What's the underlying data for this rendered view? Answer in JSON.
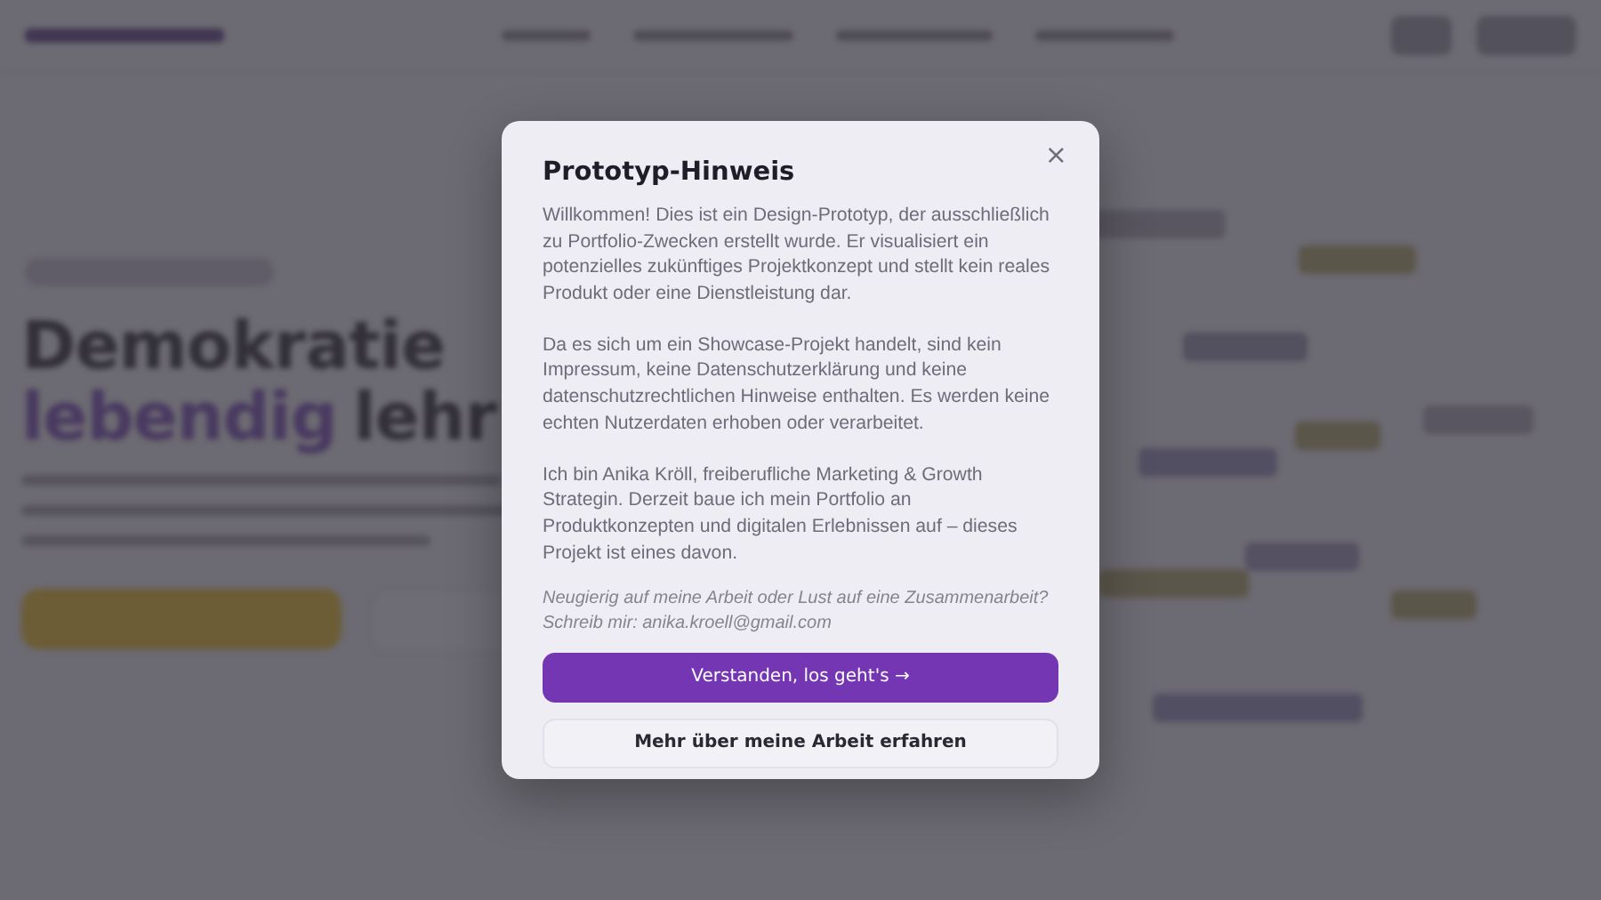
{
  "background": {
    "hero": {
      "heading_line_1": "Demokratie",
      "heading_accent": "lebendig",
      "heading_rest": "lehr"
    }
  },
  "modal": {
    "title": "Prototyp-Hinweis",
    "close": "×",
    "paragraphs": [
      "Willkommen! Dies ist ein Design-Prototyp, der ausschließlich zu Portfolio-Zwecken erstellt wurde. Er visualisiert ein potenzielles zukünftiges Projektkonzept und stellt kein reales Produkt oder eine Dienstleistung dar.",
      "Da es sich um ein Showcase-Projekt handelt, sind kein Impressum, keine Datenschutzerklärung und keine datenschutzrechtlichen Hinweise enthalten. Es werden keine echten Nutzerdaten erhoben oder verarbeitet.",
      "Ich bin Anika Kröll, freiberufliche Marketing & Growth Strategin. Derzeit baue ich mein Portfolio an Produktkonzepten und digitalen Erlebnissen auf – dieses Projekt ist eines davon."
    ],
    "note_lines": [
      "Neugierig auf meine Arbeit oder Lust auf eine Zusammenarbeit?",
      "Schreib mir: anika.kroell@gmail.com"
    ],
    "buttons": [
      {
        "label": "Verstanden, los geht's →",
        "kind": "primary"
      },
      {
        "label": "Mehr über meine Arbeit erfahren",
        "kind": "secondary"
      }
    ]
  }
}
